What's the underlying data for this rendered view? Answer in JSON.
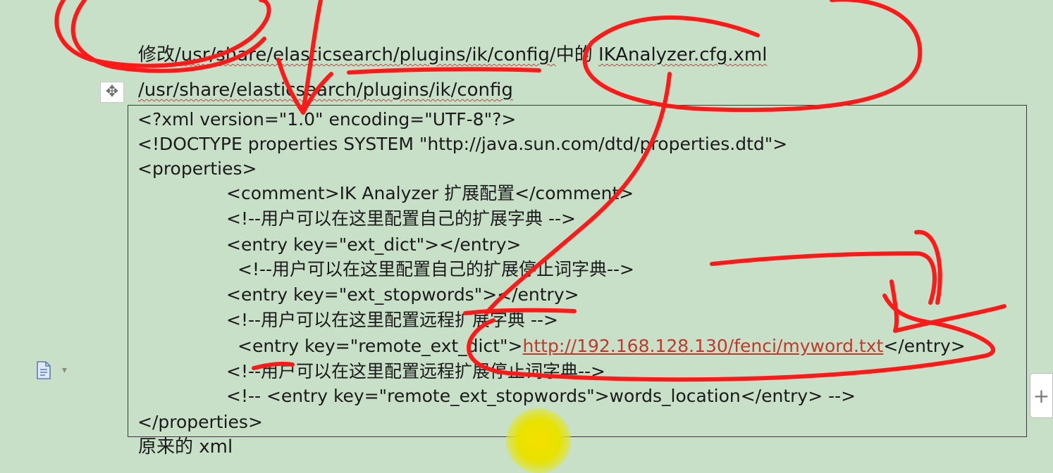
{
  "heading": {
    "prefix": "修改",
    "path": "/usr/share/elasticsearch/plugins/ik/config/",
    "middle": "中的",
    "file": "IKAnalyzer.cfg.xml"
  },
  "path_line": "/usr/share/elasticsearch/plugins/ik/config",
  "code": {
    "l1": "<?xml version=\"1.0\" encoding=\"UTF-8\"?>",
    "l2": "<!DOCTYPE properties SYSTEM \"http://java.sun.com/dtd/properties.dtd\">",
    "l3": "<properties>",
    "l4": "<comment>IK Analyzer 扩展配置</comment>",
    "l5": "<!--用户可以在这里配置自己的扩展字典 -->",
    "l6": "<entry key=\"ext_dict\"></entry>",
    "l7": "<!--用户可以在这里配置自己的扩展停止词字典-->",
    "l8": "<entry key=\"ext_stopwords\"></entry>",
    "l9": "<!--用户可以在这里配置远程扩展字典 -->",
    "l10_pre": "<entry key=\"remote_ext_dict\">",
    "l10_link": "http://192.168.128.130/fenci/myword.txt",
    "l10_post": "</entry>",
    "l11": "<!--用户可以在这里配置远程扩展停止词字典-->",
    "l12": "<!-- <entry key=\"remote_ext_stopwords\">words_location</entry> -->",
    "l13": "</properties>"
  },
  "below_box": "原来的 xml",
  "icons": {
    "move": "move-handle-icon",
    "doc": "document-icon",
    "plus": "plus-icon"
  },
  "colors": {
    "background": "#c8e0c8",
    "annotation": "#ff1a1a",
    "link": "#c0392b"
  }
}
